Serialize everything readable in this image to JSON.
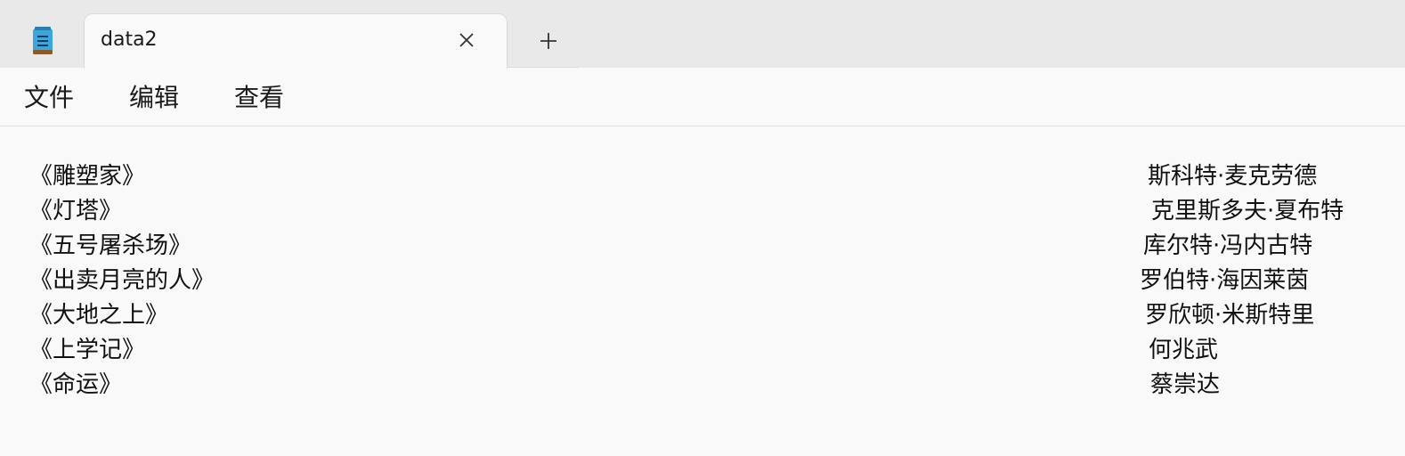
{
  "tab": {
    "title": "data2",
    "close_icon": "close-icon",
    "new_tab_icon": "plus-icon"
  },
  "app_icon": "notepad-icon",
  "menu": {
    "file": "文件",
    "edit": "编辑",
    "view": "查看"
  },
  "document": {
    "lines": [
      {
        "title": "《雕塑家》",
        "author": "斯科特·麦克劳德"
      },
      {
        "title": "《灯塔》",
        "author": "克里斯多夫·夏布特"
      },
      {
        "title": "《五号屠杀场》",
        "author": "库尔特·冯内古特"
      },
      {
        "title": "《出卖月亮的人》",
        "author": "罗伯特·海因莱茵"
      },
      {
        "title": "《大地之上》",
        "author": "罗欣顿·米斯特里"
      },
      {
        "title": "《上学记》",
        "author": "何兆武"
      },
      {
        "title": "《命运》",
        "author": "蔡崇达"
      }
    ]
  },
  "colors": {
    "tabstrip": "#e9e9e9",
    "background": "#f9f9f9",
    "text": "#111111"
  }
}
